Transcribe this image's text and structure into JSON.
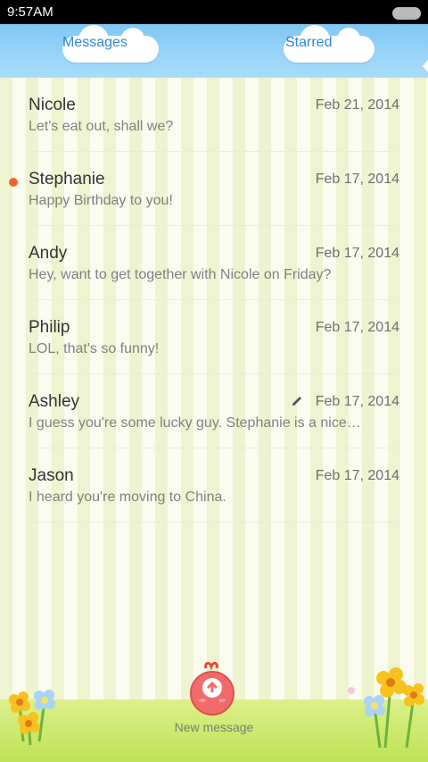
{
  "status_bar": {
    "time": "9:57AM"
  },
  "tabs": {
    "messages": "Messages",
    "starred": "Starred"
  },
  "conversations": [
    {
      "name": "Nicole",
      "date": "Feb 21, 2014",
      "preview": "Let's eat out, shall we?",
      "unread": false,
      "draft": false
    },
    {
      "name": "Stephanie",
      "date": "Feb 17, 2014",
      "preview": "Happy Birthday to you!",
      "unread": true,
      "draft": false
    },
    {
      "name": "Andy",
      "date": "Feb 17, 2014",
      "preview": "Hey, want to get together with Nicole on Friday?",
      "unread": false,
      "draft": false
    },
    {
      "name": "Philip",
      "date": "Feb 17, 2014",
      "preview": "LOL, that's so funny!",
      "unread": false,
      "draft": false
    },
    {
      "name": "Ashley",
      "date": "Feb 17, 2014",
      "preview": "I guess you're some lucky guy. Stephanie is a nice…",
      "unread": false,
      "draft": true
    },
    {
      "name": "Jason",
      "date": "Feb 17, 2014",
      "preview": "I heard you're moving to China.",
      "unread": false,
      "draft": false
    }
  ],
  "footer": {
    "new_message_label": "New message"
  },
  "colors": {
    "tab_text": "#2f86de",
    "unread_dot": "#f2662a",
    "header": "#7fc8f5",
    "grass": "#c8e866"
  },
  "icons": {
    "compose": "compose-icon",
    "draft": "pencil-icon"
  }
}
